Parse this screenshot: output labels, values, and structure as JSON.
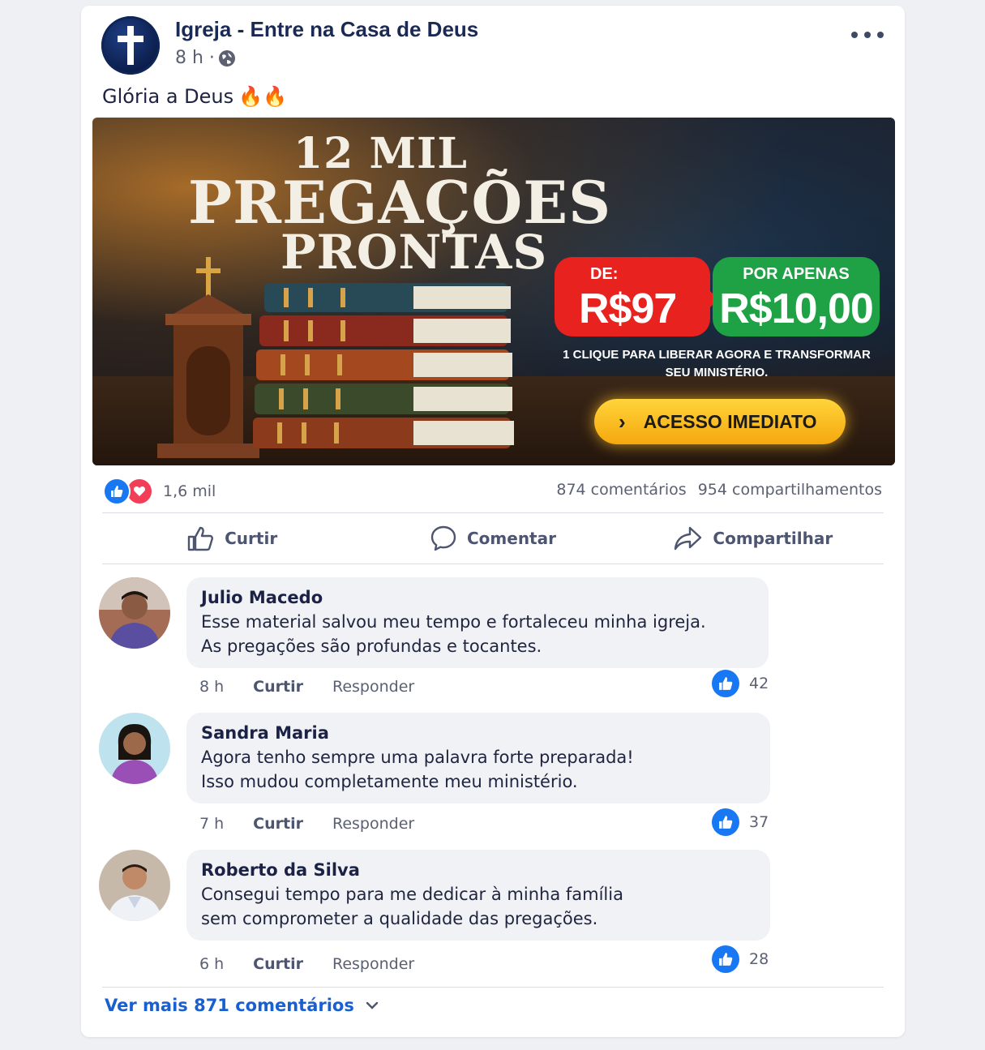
{
  "post": {
    "page_name": "Igreja - Entre na Casa de Deus",
    "time": "8 h ·",
    "text": "Glória a Deus",
    "text_emoji": "🔥🔥"
  },
  "ad": {
    "title_line1": "12 MIL",
    "title_line2": "PREGAÇÕES",
    "title_line3": "PRONTAS",
    "old_label": "DE:",
    "old_price": "R$97",
    "new_label": "POR APENAS",
    "new_price": "R$10,00",
    "description": "1 CLIQUE PARA LIBERAR AGORA E TRANSFORMAR SEU MINISTÉRIO.",
    "cta": "ACESSO IMEDIATO"
  },
  "reactions": {
    "count": "1,6 mil",
    "comments": "874 comentários",
    "shares": "954 compartilhamentos"
  },
  "actions": {
    "like": "Curtir",
    "comment": "Comentar",
    "share": "Compartilhar"
  },
  "comments": [
    {
      "name": "Julio Macedo",
      "line1": "Esse material salvou meu tempo e fortaleceu minha igreja.",
      "line2": "As pregações são profundas e tocantes.",
      "time": "8 h",
      "like": "Curtir",
      "reply": "Responder",
      "likes": "42"
    },
    {
      "name": "Sandra Maria",
      "line1": "Agora tenho sempre uma palavra forte preparada!",
      "line2": "Isso mudou completamente meu ministério.",
      "time": "7 h",
      "like": "Curtir",
      "reply": "Responder",
      "likes": "37"
    },
    {
      "name": "Roberto da Silva",
      "line1": "Consegui tempo para me dedicar à minha família",
      "line2": "sem comprometer a qualidade das pregações.",
      "time": "6 h",
      "like": "Curtir",
      "reply": "Responder",
      "likes": "28"
    }
  ],
  "see_more": "Ver mais 871 comentários",
  "colors": {
    "accent": "#1877f2",
    "love": "#f33e58",
    "old_price": "#e8221f",
    "new_price": "#1fa245",
    "cta": "#f5b81a"
  },
  "icons": [
    "cross-icon",
    "globe-icon",
    "more-icon",
    "like-icon",
    "love-icon",
    "thumb-up-icon",
    "comment-icon",
    "share-icon",
    "chevron-right-icon",
    "chevron-down-icon"
  ]
}
